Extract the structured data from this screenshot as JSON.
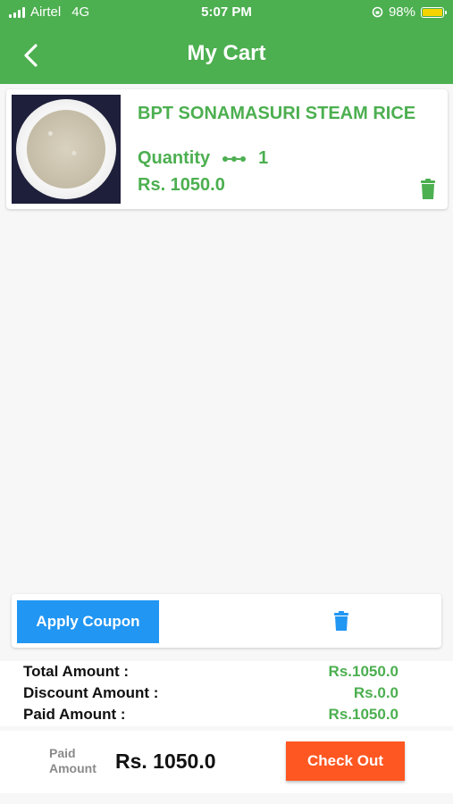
{
  "status_bar": {
    "carrier": "Airtel",
    "network": "4G",
    "time": "5:07 PM",
    "battery": "98%",
    "battery_level": 0.98
  },
  "header": {
    "title": "My Cart",
    "back_icon": "chevron-left-icon"
  },
  "cart": {
    "items": [
      {
        "name": "BPT SONAMASURI STEAM RICE",
        "quantity_label": "Quantity",
        "quantity": "1",
        "price": "Rs. 1050.0"
      }
    ]
  },
  "coupon": {
    "apply_label": "Apply Coupon",
    "delete_icon": "trash-icon"
  },
  "summary": {
    "total_label": "Total Amount :",
    "total_value": "Rs.1050.0",
    "discount_label": "Discount Amount :",
    "discount_value": "Rs.0.0",
    "paid_label": "Paid Amount :",
    "paid_value": "Rs.1050.0"
  },
  "footer": {
    "paid_label_line1": "Paid",
    "paid_label_line2": "Amount",
    "paid_value": "Rs. 1050.0",
    "checkout_label": "Check Out"
  },
  "colors": {
    "primary_green": "#4caf50",
    "coupon_blue": "#2196f3",
    "checkout_orange": "#ff5722"
  }
}
